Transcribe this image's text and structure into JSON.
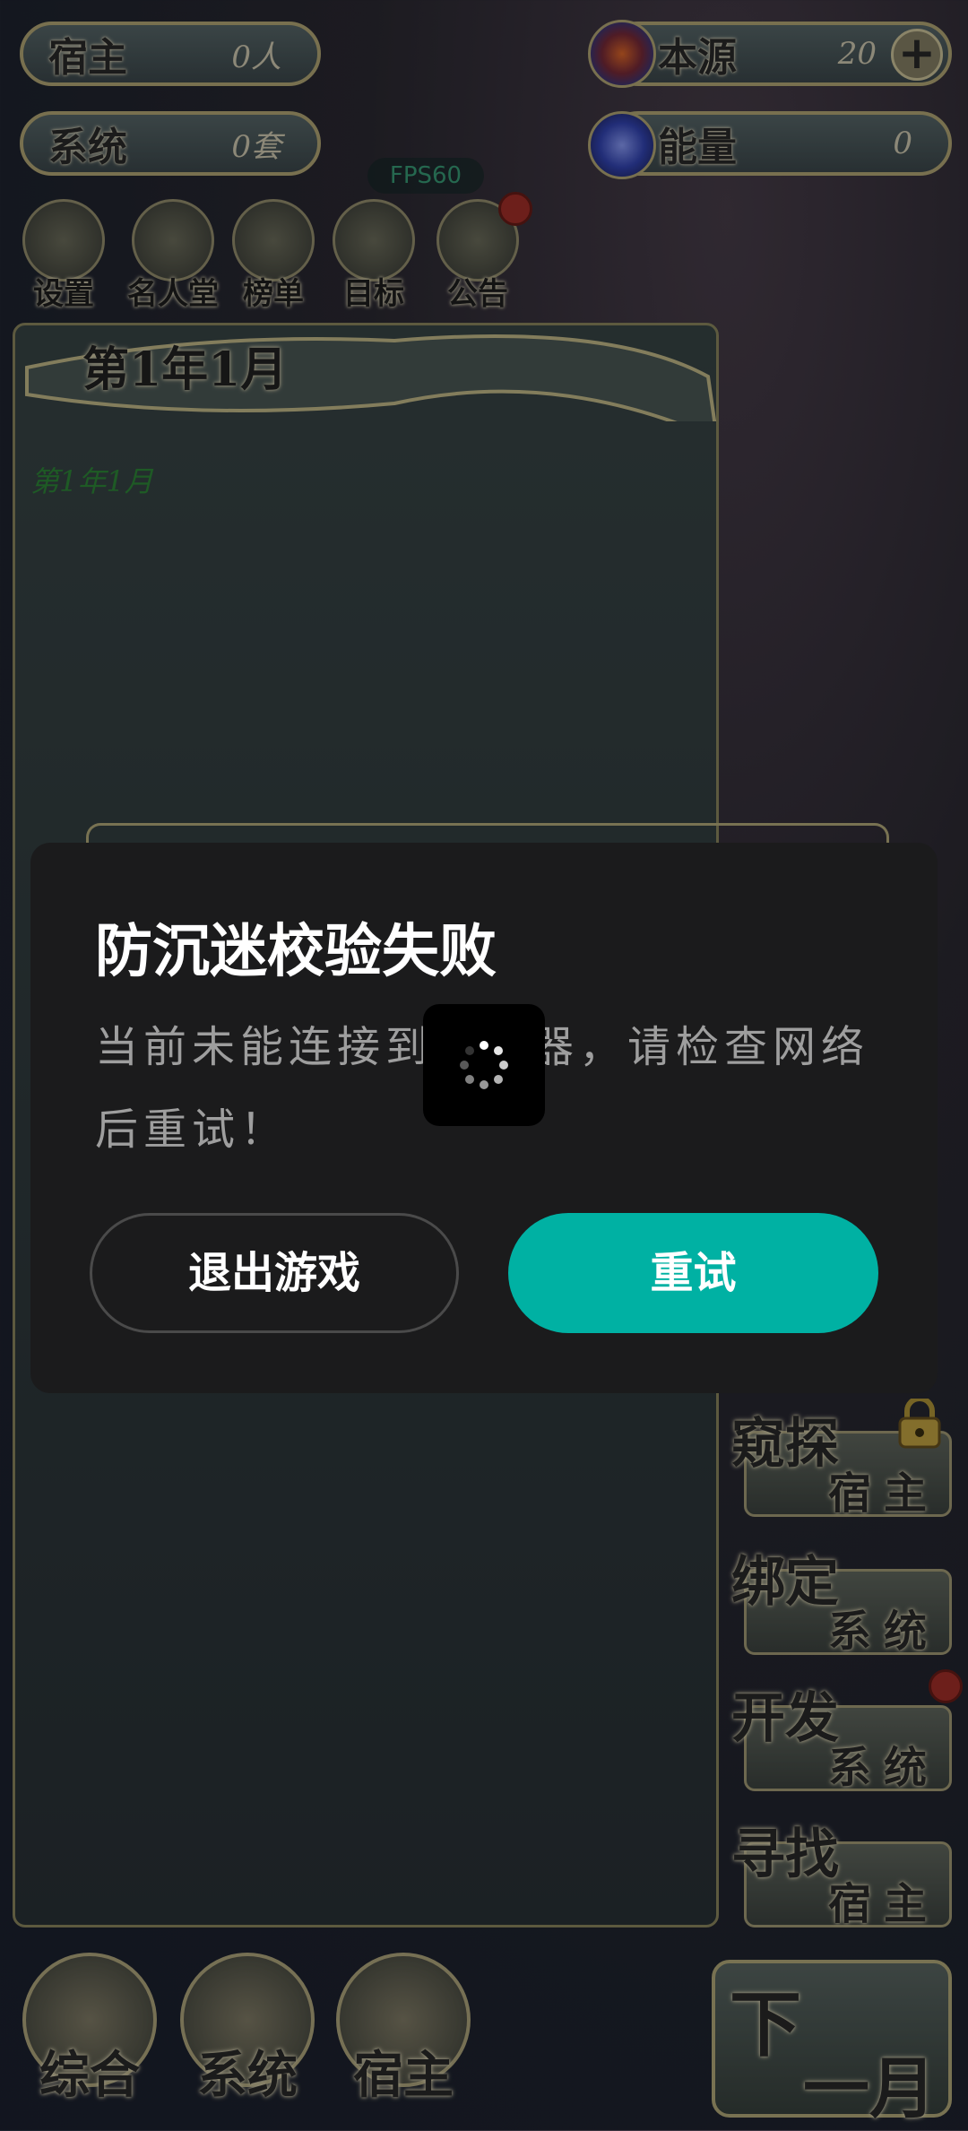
{
  "hud": {
    "host_label": "宿主",
    "host_value": "0人",
    "system_label": "系统",
    "system_value": "0套",
    "origin_label": "本源",
    "origin_value": "20",
    "energy_label": "能量",
    "energy_value": "0",
    "fps": "FPS60"
  },
  "top_menu": [
    {
      "label": "设置",
      "icon": "gear-icon"
    },
    {
      "label": "名人堂",
      "icon": "helmet-icon"
    },
    {
      "label": "榜单",
      "icon": "crystal-icon"
    },
    {
      "label": "目标",
      "icon": "scroll-icon"
    },
    {
      "label": "公告",
      "icon": "drop-icon",
      "badge": true
    }
  ],
  "log_panel": {
    "date_title": "第1年1月",
    "entries": [
      "第1年1月"
    ]
  },
  "side_buttons": [
    {
      "big": "窥探",
      "small": "宿主",
      "locked": true
    },
    {
      "big": "绑定",
      "small": "系统"
    },
    {
      "big": "开发",
      "small": "系统",
      "badge": true
    },
    {
      "big": "寻找",
      "small": "宿主"
    }
  ],
  "bottom_nav": [
    {
      "label": "综合",
      "icon": "scroll-gold-icon"
    },
    {
      "label": "系统",
      "icon": "taiji-icon"
    },
    {
      "label": "宿主",
      "icon": "character-icon"
    }
  ],
  "next_month": {
    "top": "下",
    "bottom": "一月"
  },
  "dialog": {
    "title": "防沉迷校验失败",
    "message": "当前未能连接到服务器，请检查网络后重试！",
    "exit_label": "退出游戏",
    "retry_label": "重试"
  },
  "colors": {
    "accent": "#00b1a3",
    "dialog_bg": "#1b1b1c",
    "log_text": "#2f8a3a"
  }
}
